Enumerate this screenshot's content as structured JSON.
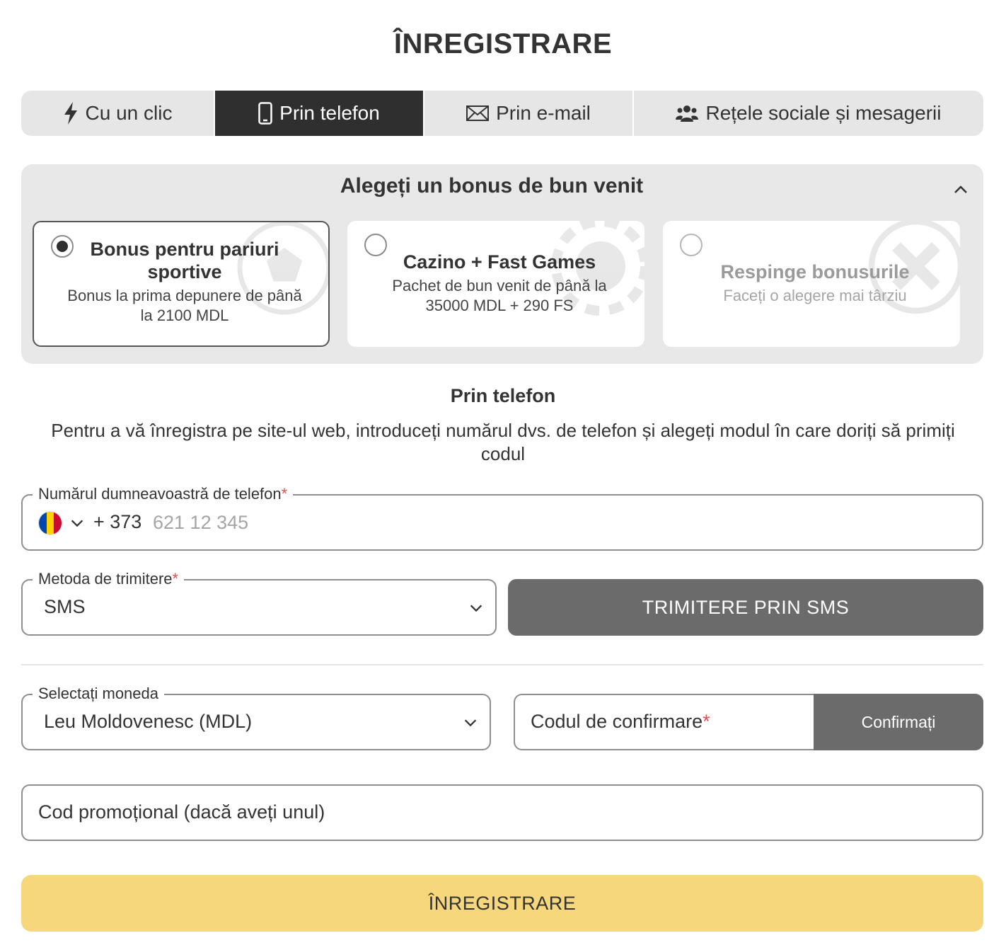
{
  "page": {
    "title": "ÎNREGISTRARE"
  },
  "tabs": [
    {
      "label": "Cu un clic",
      "icon": "lightning-icon",
      "active": false
    },
    {
      "label": "Prin telefon",
      "icon": "smartphone-icon",
      "active": true
    },
    {
      "label": "Prin e-mail",
      "icon": "envelope-icon",
      "active": false
    },
    {
      "label": "Rețele sociale și mesagerii",
      "icon": "users-icon",
      "active": false
    }
  ],
  "bonus": {
    "title": "Alegeți un bonus de bun venit",
    "options": [
      {
        "title": "Bonus pentru pariuri sportive",
        "desc": "Bonus la prima depunere de până la 2100 MDL",
        "selected": true,
        "icon": "soccer-ball-icon"
      },
      {
        "title": "Cazino + Fast Games",
        "desc": "Pachet de bun venit de până la 35000 MDL + 290 FS",
        "selected": false,
        "icon": "casino-chip-icon"
      },
      {
        "title": "Respinge bonusurile",
        "desc": "Faceți o alegere mai târziu",
        "selected": false,
        "icon": "cross-icon"
      }
    ]
  },
  "section": {
    "title": "Prin telefon",
    "description": "Pentru a vă înregistra pe site-ul web, introduceți numărul dvs. de telefon și alegeți modul în care doriți să primiți codul"
  },
  "phone": {
    "label": "Numărul dumneavoastră de telefon",
    "required_mark": "*",
    "prefix": "+ 373",
    "placeholder": "621 12 345",
    "flag_colors": [
      "#0046ae",
      "#ffd200",
      "#cc092f"
    ]
  },
  "method": {
    "label": "Metoda de trimitere",
    "required_mark": "*",
    "value": "SMS",
    "send_button": "TRIMITERE PRIN SMS"
  },
  "currency": {
    "label": "Selectați moneda",
    "value": "Leu Moldovenesc (MDL)"
  },
  "confirmation": {
    "placeholder": "Codul de confirmare",
    "required_mark": "*",
    "button": "Confirmați"
  },
  "promo": {
    "placeholder": "Cod promoțional (dacă aveți unul)"
  },
  "submit": {
    "label": "ÎNREGISTRARE"
  },
  "colors": {
    "tab_active": "#2f2f2f",
    "button_gray": "#6b6b6b",
    "register_yellow": "#f7d77c",
    "required": "#d9534f"
  }
}
